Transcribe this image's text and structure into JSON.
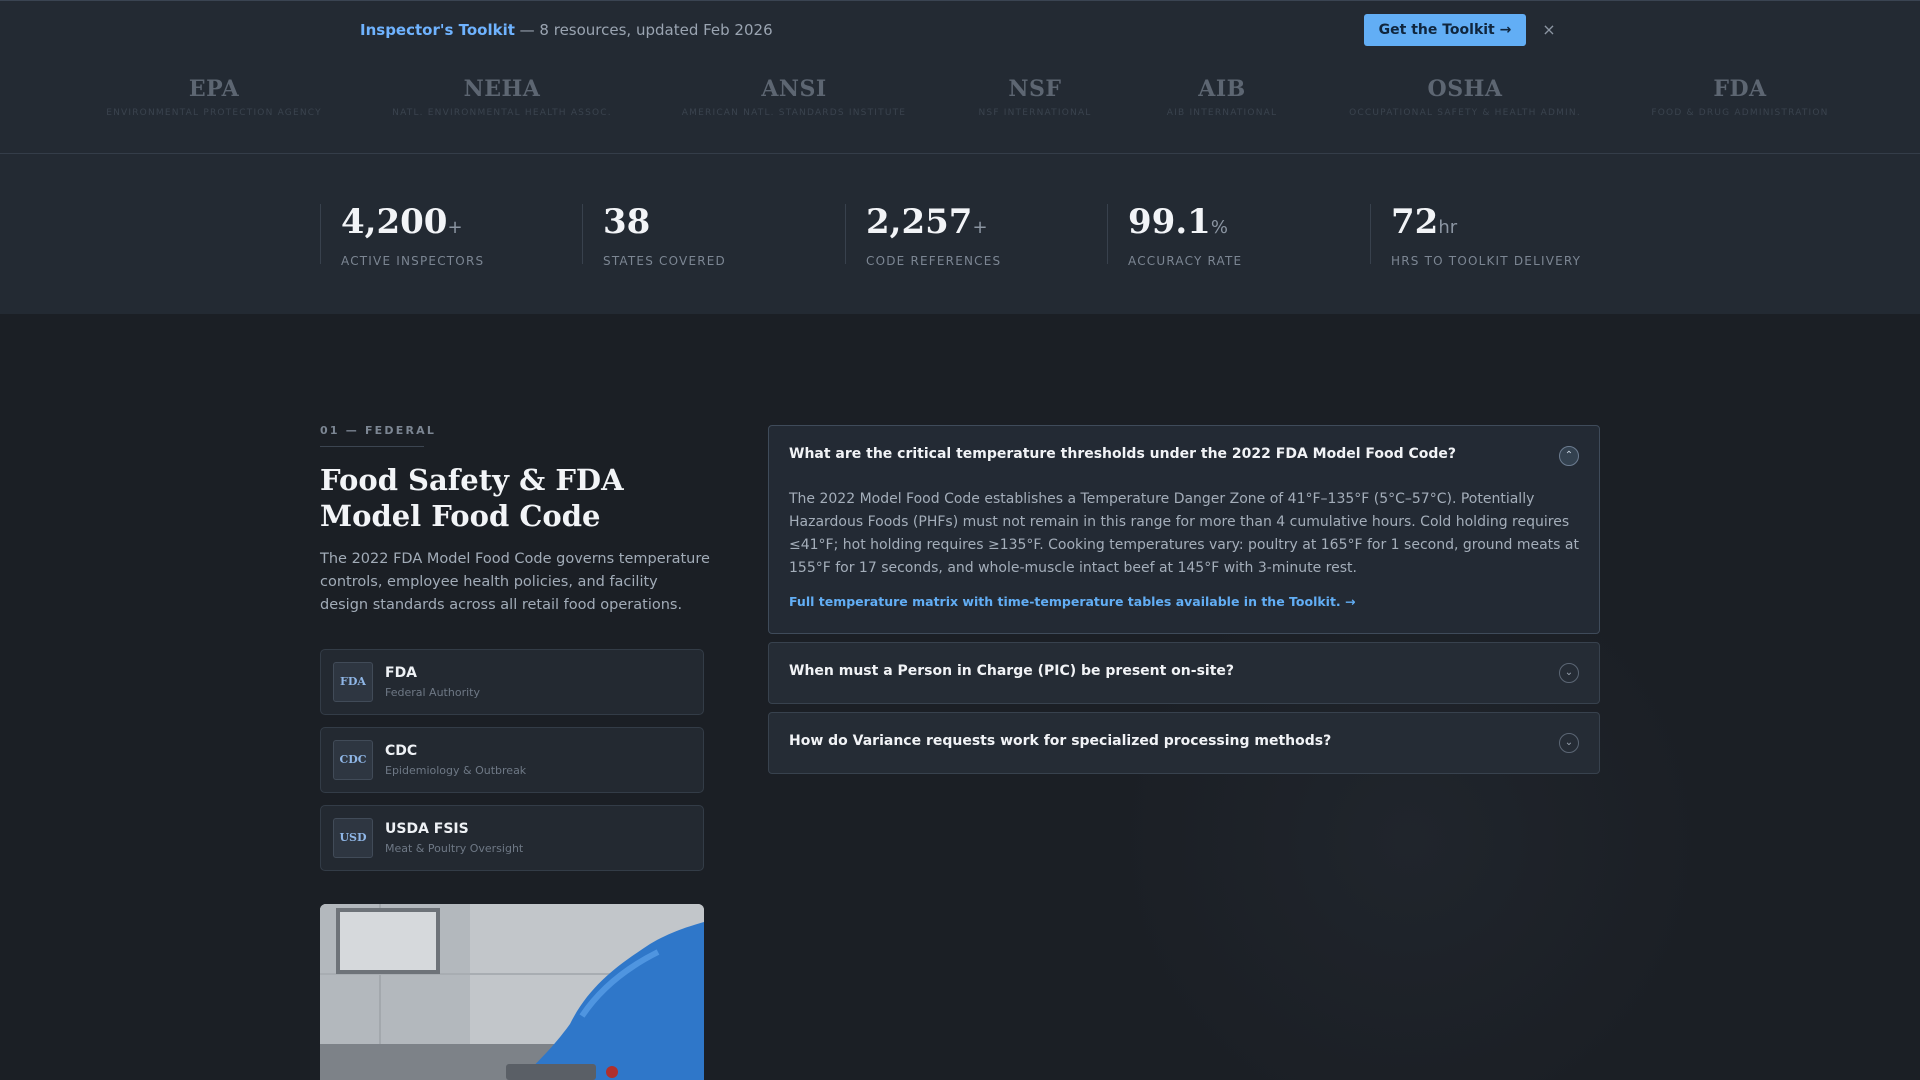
{
  "banner": {
    "brand": "Inspector's Toolkit",
    "message": " — 8 resources, updated Feb 2026",
    "cta_label": "Get the Toolkit →",
    "close_glyph": "×"
  },
  "agencies": [
    {
      "abbr": "EPA",
      "full": "ENVIRONMENTAL PROTECTION AGENCY"
    },
    {
      "abbr": "NEHA",
      "full": "NATL. ENVIRONMENTAL HEALTH ASSOC."
    },
    {
      "abbr": "ANSI",
      "full": "AMERICAN NATL. STANDARDS INSTITUTE"
    },
    {
      "abbr": "NSF",
      "full": "NSF INTERNATIONAL"
    },
    {
      "abbr": "AIB",
      "full": "AIB INTERNATIONAL"
    },
    {
      "abbr": "OSHA",
      "full": "OCCUPATIONAL SAFETY & HEALTH ADMIN."
    },
    {
      "abbr": "FDA",
      "full": "FOOD & DRUG ADMINISTRATION"
    }
  ],
  "stats": [
    {
      "value": "4,200",
      "unit": "+",
      "label": "ACTIVE INSPECTORS"
    },
    {
      "value": "38",
      "unit": "",
      "label": "STATES COVERED"
    },
    {
      "value": "2,257",
      "unit": "+",
      "label": "CODE REFERENCES"
    },
    {
      "value": "99.1",
      "unit": "%",
      "label": "ACCURACY RATE"
    },
    {
      "value": "72",
      "unit": "hr",
      "label": "HRS TO TOOLKIT DELIVERY"
    }
  ],
  "section": {
    "eyebrow": "01 — FEDERAL",
    "title": "Food Safety & FDA Model Food Code",
    "description": "The 2022 FDA Model Food Code governs temperature controls, employee health policies, and facility design standards across all retail food operations.",
    "authorities": [
      {
        "badge": "FDA",
        "name": "FDA",
        "sub": "Federal Authority"
      },
      {
        "badge": "CDC",
        "name": "CDC",
        "sub": "Epidemiology & Outbreak"
      },
      {
        "badge": "USD",
        "name": "USDA FSIS",
        "sub": "Meat & Poultry Oversight"
      }
    ]
  },
  "faq": [
    {
      "question": "What are the critical temperature thresholds under the 2022 FDA Model Food Code?",
      "answer": "The 2022 Model Food Code establishes a Temperature Danger Zone of 41°F–135°F (5°C–57°C). Potentially Hazardous Foods (PHFs) must not remain in this range for more than 4 cumulative hours. Cold holding requires ≤41°F; hot holding requires ≥135°F. Cooking temperatures vary: poultry at 165°F for 1 second, ground meats at 155°F for 17 seconds, and whole-muscle intact beef at 145°F with 3-minute rest.",
      "link": "Full temperature matrix with time-temperature tables available in the Toolkit.  →",
      "toggle": "⌃"
    },
    {
      "question": "When must a Person in Charge (PIC) be present on-site?",
      "toggle": "⌄"
    },
    {
      "question": "How do Variance requests work for specialized processing methods?",
      "toggle": "⌄"
    }
  ],
  "colors": {
    "accent": "#62aef5",
    "background": "#1b1f25",
    "panel": "#232a33"
  }
}
